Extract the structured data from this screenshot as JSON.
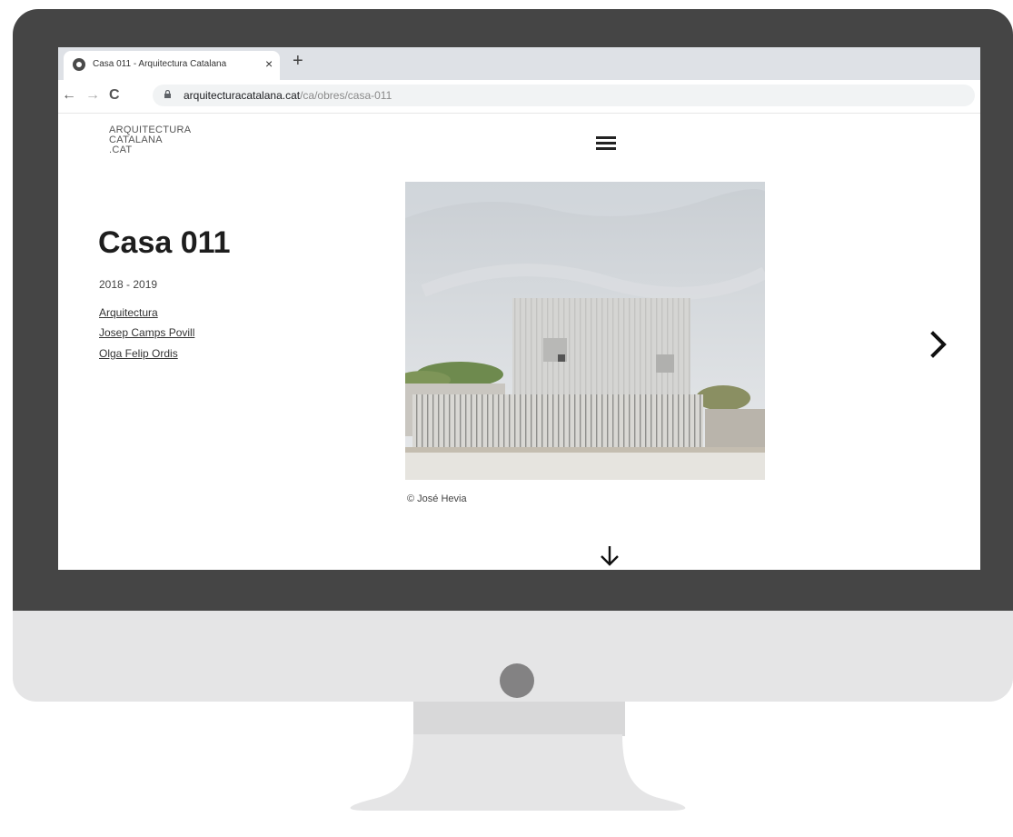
{
  "browser": {
    "tab_title": "Casa 011 - Arquitectura Catalana",
    "tab_close": "×",
    "new_tab": "+",
    "nav": {
      "back": "←",
      "forward": "→",
      "reload": "C"
    },
    "url_domain": "arquitecturacatalana.cat",
    "url_path": "/ca/obres/casa-011"
  },
  "site": {
    "logo_line1": "ARQUITECTURA",
    "logo_line2": "CATALANA",
    "logo_line3": ".CAT"
  },
  "work": {
    "title": "Casa 011",
    "years": "2018 - 2019",
    "credits": [
      "Arquitectura",
      "Josep Camps Povill",
      "Olga Felip Ordis"
    ]
  },
  "photo": {
    "credit": "© José Hevia"
  },
  "colors": {
    "bezel": "#454545",
    "chin": "#e5e5e6",
    "camera": "#838283",
    "text_dark": "#1d1d1d"
  },
  "icons": {
    "menu": "hamburger-icon",
    "next": "chevron-right-icon",
    "scroll": "arrow-down-icon"
  }
}
